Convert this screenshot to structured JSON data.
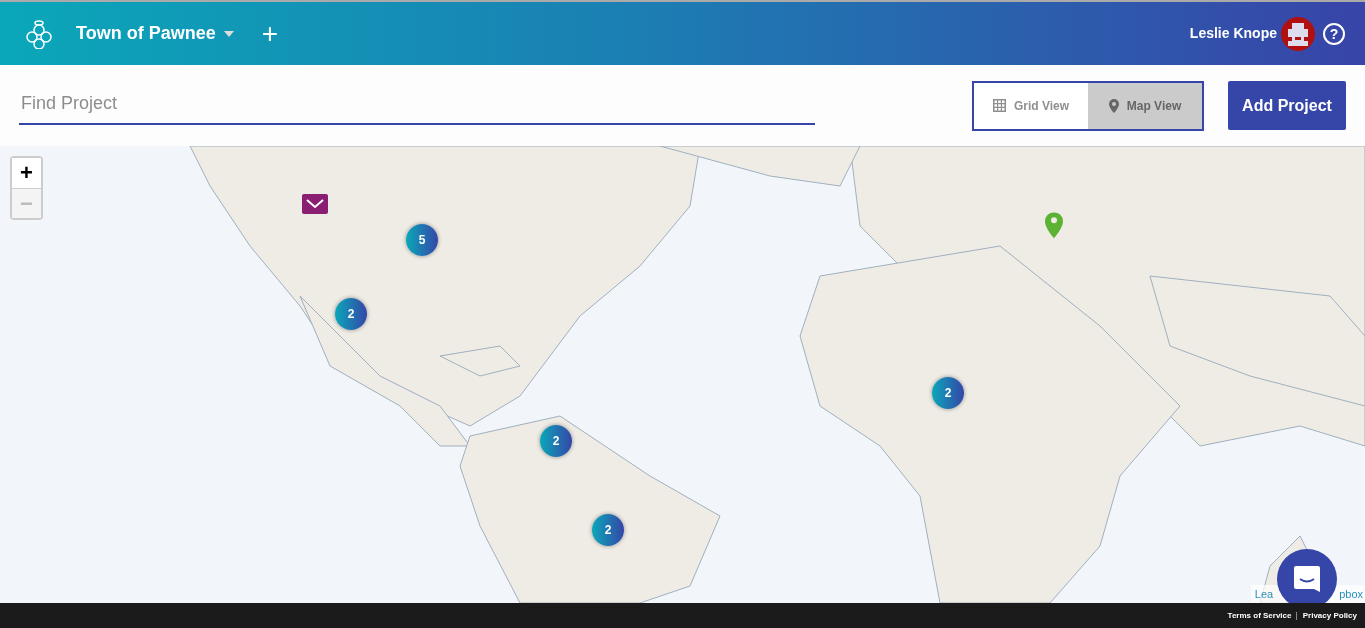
{
  "header": {
    "org_name": "Town of Pawnee",
    "add_symbol": "+",
    "user_name": "Leslie Knope",
    "help_symbol": "?"
  },
  "search": {
    "placeholder": "Find Project"
  },
  "view_toggle": [
    {
      "label": "Grid View",
      "kind": "grid",
      "selected": false
    },
    {
      "label": "Map View",
      "kind": "map",
      "selected": true
    }
  ],
  "add_button": "Add Project",
  "map": {
    "zoom_in": "+",
    "zoom_out": "−",
    "zoom_out_disabled": true,
    "markers": [
      {
        "kind": "envelope",
        "color": "#8a1e73"
      },
      {
        "kind": "cluster",
        "count": "5"
      },
      {
        "kind": "cluster",
        "count": "2"
      },
      {
        "kind": "cluster",
        "count": "2"
      },
      {
        "kind": "cluster",
        "count": "2"
      },
      {
        "kind": "cluster",
        "count": "2"
      },
      {
        "kind": "pin",
        "color": "#5cb233"
      }
    ],
    "attribution": [
      "Lea",
      "pbox"
    ]
  },
  "footer": {
    "links": [
      "Terms of Service",
      "Privacy Policy"
    ]
  }
}
